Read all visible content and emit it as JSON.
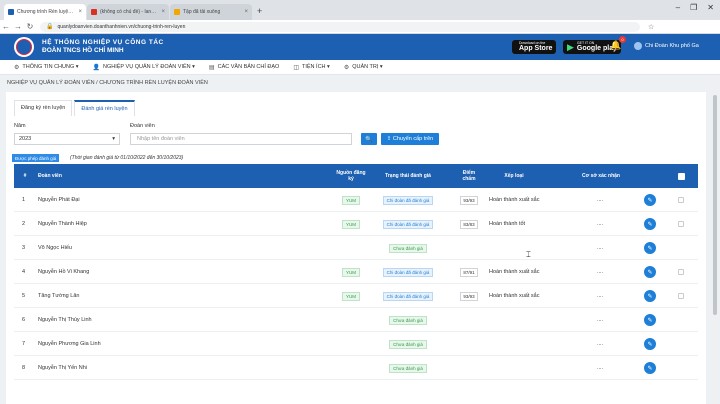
{
  "browser": {
    "tabs": [
      {
        "title": "Chương trình Rèn luyện Đoàn viê",
        "active": true
      },
      {
        "title": "(không có chủ đề) - lanNgo.dhv",
        "active": false
      },
      {
        "title": "Tập đã tải xuống",
        "active": false
      }
    ],
    "new_tab": "+",
    "url": "quanlydoanvien.doanthanhnien.vn/chuong-trinh-ren-luyen",
    "win_min": "–",
    "win_max": "❐",
    "win_close": "✕"
  },
  "header": {
    "title_line1": "HỆ THỐNG NGHIỆP VỤ CÔNG TÁC",
    "title_line2": "ĐOÀN TNCS HỒ CHÍ MINH",
    "appstore_small": "Download on the",
    "appstore_big": "App Store",
    "google_small": "GET IT ON",
    "google_big": "Google play",
    "notif_count": "0",
    "user_name": "Chi Đoàn Khu phố Ga"
  },
  "menu": [
    {
      "label": "THÔNG TIN CHUNG ▾",
      "icon": "gear-icon",
      "glyph": "⚙"
    },
    {
      "label": "NGHIỆP VỤ QUẢN LÝ ĐOÀN VIÊN ▾",
      "icon": "user-icon",
      "glyph": "👤"
    },
    {
      "label": "CÁC VĂN BẢN CHỈ ĐẠO",
      "icon": "document-icon",
      "glyph": "▤"
    },
    {
      "label": "TIỆN ÍCH ▾",
      "icon": "apps-icon",
      "glyph": "◫"
    },
    {
      "label": "QUẢN TRỊ ▾",
      "icon": "admin-icon",
      "glyph": "⚙"
    }
  ],
  "breadcrumb": "NGHIỆP VỤ QUẢN LÝ ĐOÀN VIÊN  /  CHƯƠNG TRÌNH RÈN LUYỆN ĐOÀN VIÊN",
  "tabs": {
    "register": "Đăng ký rèn luyện",
    "evaluate": "Đánh giá rèn luyện"
  },
  "filters": {
    "year_label": "Năm",
    "year_value": "2023",
    "member_label": "Đoàn viên",
    "member_placeholder": "Nhập tên đoàn viên",
    "search_glyph": "🔍",
    "upload_label": "⇪  Chuyển cấp trên"
  },
  "permission": {
    "badge": "Được phép đánh giá",
    "note": "(Thời gian đánh giá từ 01/10/2022 đến 30/10/2023)"
  },
  "table": {
    "headers": {
      "stt": "#",
      "name": "Đoàn viên",
      "registered": "Nguồn đăng ký",
      "status": "Trạng thái đánh giá",
      "score": "Điểm chấm",
      "rank": "Xếp loại",
      "confirm": "Cơ sở xác nhận"
    },
    "rows": [
      {
        "stt": "1",
        "name": "Nguyễn Phát Đại",
        "reg": "YUM",
        "status": "Chi đoàn đã đánh giá",
        "status_type": "done",
        "score": "93/93",
        "rank": "Hoàn thành xuất sắc",
        "confirm": "...."
      },
      {
        "stt": "2",
        "name": "Nguyễn Thành Hiệp",
        "reg": "YUM",
        "status": "Chi đoàn đã đánh giá",
        "status_type": "done",
        "score": "83/83",
        "rank": "Hoàn thành tốt",
        "confirm": "...."
      },
      {
        "stt": "3",
        "name": "Võ Ngọc Hiếu",
        "reg": "",
        "status": "Chưa đánh giá",
        "status_type": "wait",
        "score": "",
        "rank": "",
        "confirm": "...."
      },
      {
        "stt": "4",
        "name": "Nguyễn Hồ Vi Khang",
        "reg": "YUM",
        "status": "Chi đoàn đã đánh giá",
        "status_type": "done",
        "score": "87/91",
        "rank": "Hoàn thành xuất sắc",
        "confirm": "...."
      },
      {
        "stt": "5",
        "name": "Tăng Tường Lân",
        "reg": "YUM",
        "status": "Chi đoàn đã đánh giá",
        "status_type": "done",
        "score": "93/93",
        "rank": "Hoàn thành xuất sắc",
        "confirm": "...."
      },
      {
        "stt": "6",
        "name": "Nguyễn Thị Thùy Linh",
        "reg": "",
        "status": "Chưa đánh giá",
        "status_type": "wait",
        "score": "",
        "rank": "",
        "confirm": "...."
      },
      {
        "stt": "7",
        "name": "Nguyễn Phương Gia Linh",
        "reg": "",
        "status": "Chưa đánh giá",
        "status_type": "wait",
        "score": "",
        "rank": "",
        "confirm": "...."
      },
      {
        "stt": "8",
        "name": "Nguyễn Thị Yến Nhi",
        "reg": "",
        "status": "Chưa đánh giá",
        "status_type": "wait",
        "score": "",
        "rank": "",
        "confirm": "...."
      }
    ]
  },
  "icons": {
    "edit": "✎",
    "back": "←",
    "forward": "→",
    "reload": "↻",
    "lock": "🔒",
    "star": "☆",
    "bell": "🔔",
    "apple": "",
    "play": "▶",
    "close_tab": "×",
    "caret": "▾"
  },
  "colors": {
    "primary": "#1d5fb0",
    "accent": "#1d7fd8",
    "success": "#2e9d4a"
  }
}
